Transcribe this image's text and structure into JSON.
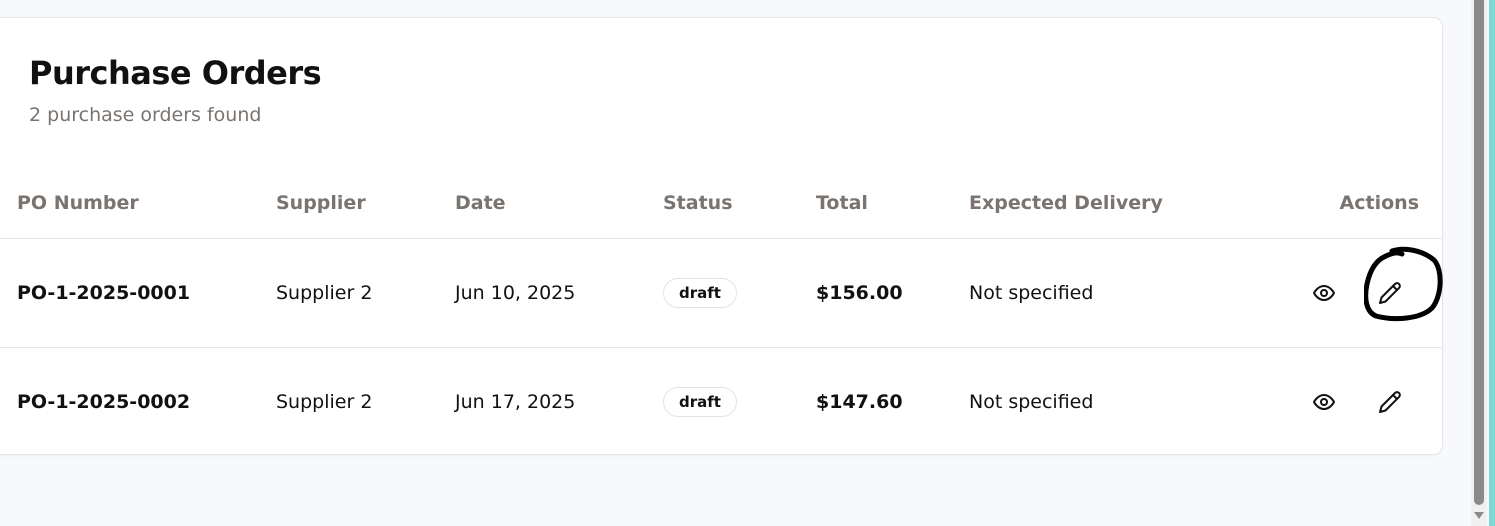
{
  "page": {
    "title": "Purchase Orders",
    "subtitle": "2 purchase orders found"
  },
  "table": {
    "headers": [
      "PO Number",
      "Supplier",
      "Date",
      "Status",
      "Total",
      "Expected Delivery",
      "Actions"
    ],
    "rows": [
      {
        "po": "PO-1-2025-0001",
        "supplier": "Supplier 2",
        "date": "Jun 10, 2025",
        "status": "draft",
        "total": "$156.00",
        "delivery": "Not specified"
      },
      {
        "po": "PO-1-2025-0002",
        "supplier": "Supplier 2",
        "date": "Jun 17, 2025",
        "status": "draft",
        "total": "$147.60",
        "delivery": "Not specified"
      }
    ]
  },
  "icons": {
    "view": "eye-icon",
    "edit": "pencil-icon",
    "annotation": "hand-drawn-circle"
  }
}
